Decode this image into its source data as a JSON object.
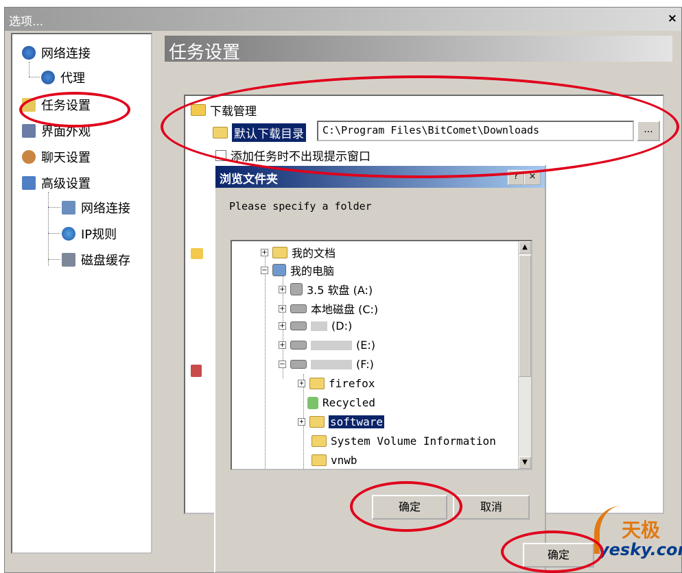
{
  "window": {
    "title": "选项...",
    "close": "×"
  },
  "sidebar": {
    "items": [
      {
        "label": "网络连接",
        "icon": "globe-icon"
      },
      {
        "label": "代理",
        "icon": "globe-icon"
      },
      {
        "label": "任务设置",
        "icon": "folder-open-icon"
      },
      {
        "label": "界面外观",
        "icon": "monitor-icon"
      },
      {
        "label": "聊天设置",
        "icon": "people-icon"
      },
      {
        "label": "高级设置",
        "icon": "settings-icon"
      },
      {
        "label": "网络连接",
        "icon": "network-icon"
      },
      {
        "label": "IP规则",
        "icon": "ip-rule-icon"
      },
      {
        "label": "磁盘缓存",
        "icon": "disk-cache-icon"
      }
    ]
  },
  "panel": {
    "title": "任务设置"
  },
  "download": {
    "section_label": "下载管理",
    "dir_label": "默认下载目录",
    "dir_value": "C:\\Program Files\\BitComet\\Downloads",
    "browse_label": "...",
    "no_prompt_label": "添加任务时不出现提示窗口"
  },
  "browse_dialog": {
    "title": "浏览文件夹",
    "help": "?",
    "close": "×",
    "prompt": "Please specify a folder",
    "tree": [
      {
        "label": "我的文档"
      },
      {
        "label": "我的电脑"
      },
      {
        "label": "3.5 软盘 (A:)"
      },
      {
        "label": "本地磁盘 (C:)"
      },
      {
        "label": "(D:)"
      },
      {
        "label": "(E:)"
      },
      {
        "label": "(F:)"
      },
      {
        "label": "firefox"
      },
      {
        "label": "Recycled"
      },
      {
        "label": "software"
      },
      {
        "label": "System Volume Information"
      },
      {
        "label": "vnwb"
      }
    ],
    "ok_label": "确定",
    "cancel_label": "取消"
  },
  "main_ok_label": "确定",
  "watermark": {
    "line1": "天极",
    "line2": "yesky.com"
  },
  "colors": {
    "highlight": "#0a246a",
    "annotation": "#e0001b"
  }
}
